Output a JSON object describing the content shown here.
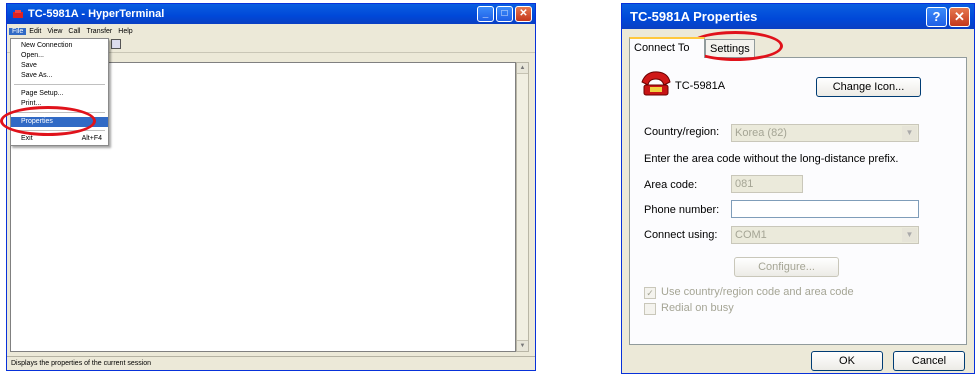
{
  "left_window": {
    "title": "TC-5981A - HyperTerminal",
    "menus": [
      "File",
      "Edit",
      "View",
      "Call",
      "Transfer",
      "Help"
    ],
    "file_menu": {
      "items": [
        "New Connection",
        "Open...",
        "Save",
        "Save As...",
        "Page Setup...",
        "Print...",
        "Properties",
        "Exit"
      ],
      "exit_shortcut": "Alt+F4",
      "selected": "Properties"
    },
    "status_text": "Displays the properties of the current session"
  },
  "dialog": {
    "title": "TC-5981A Properties",
    "tabs": [
      "Connect To",
      "Settings"
    ],
    "active_tab": "Connect To",
    "connection_name": "TC-5981A",
    "change_icon_label": "Change Icon...",
    "country_label": "Country/region:",
    "country_value": "Korea (82)",
    "hint": "Enter the area code without the long-distance prefix.",
    "area_label": "Area code:",
    "area_value": "081",
    "phone_label": "Phone number:",
    "phone_value": "",
    "connect_label": "Connect using:",
    "connect_value": "COM1",
    "configure_label": "Configure...",
    "use_code_label": "Use country/region code and area code",
    "redial_label": "Redial on busy",
    "ok_label": "OK",
    "cancel_label": "Cancel"
  },
  "colors": {
    "highlight_ring": "#e0121b",
    "title_blue": "#0048d8",
    "menu_select": "#316ac5"
  }
}
